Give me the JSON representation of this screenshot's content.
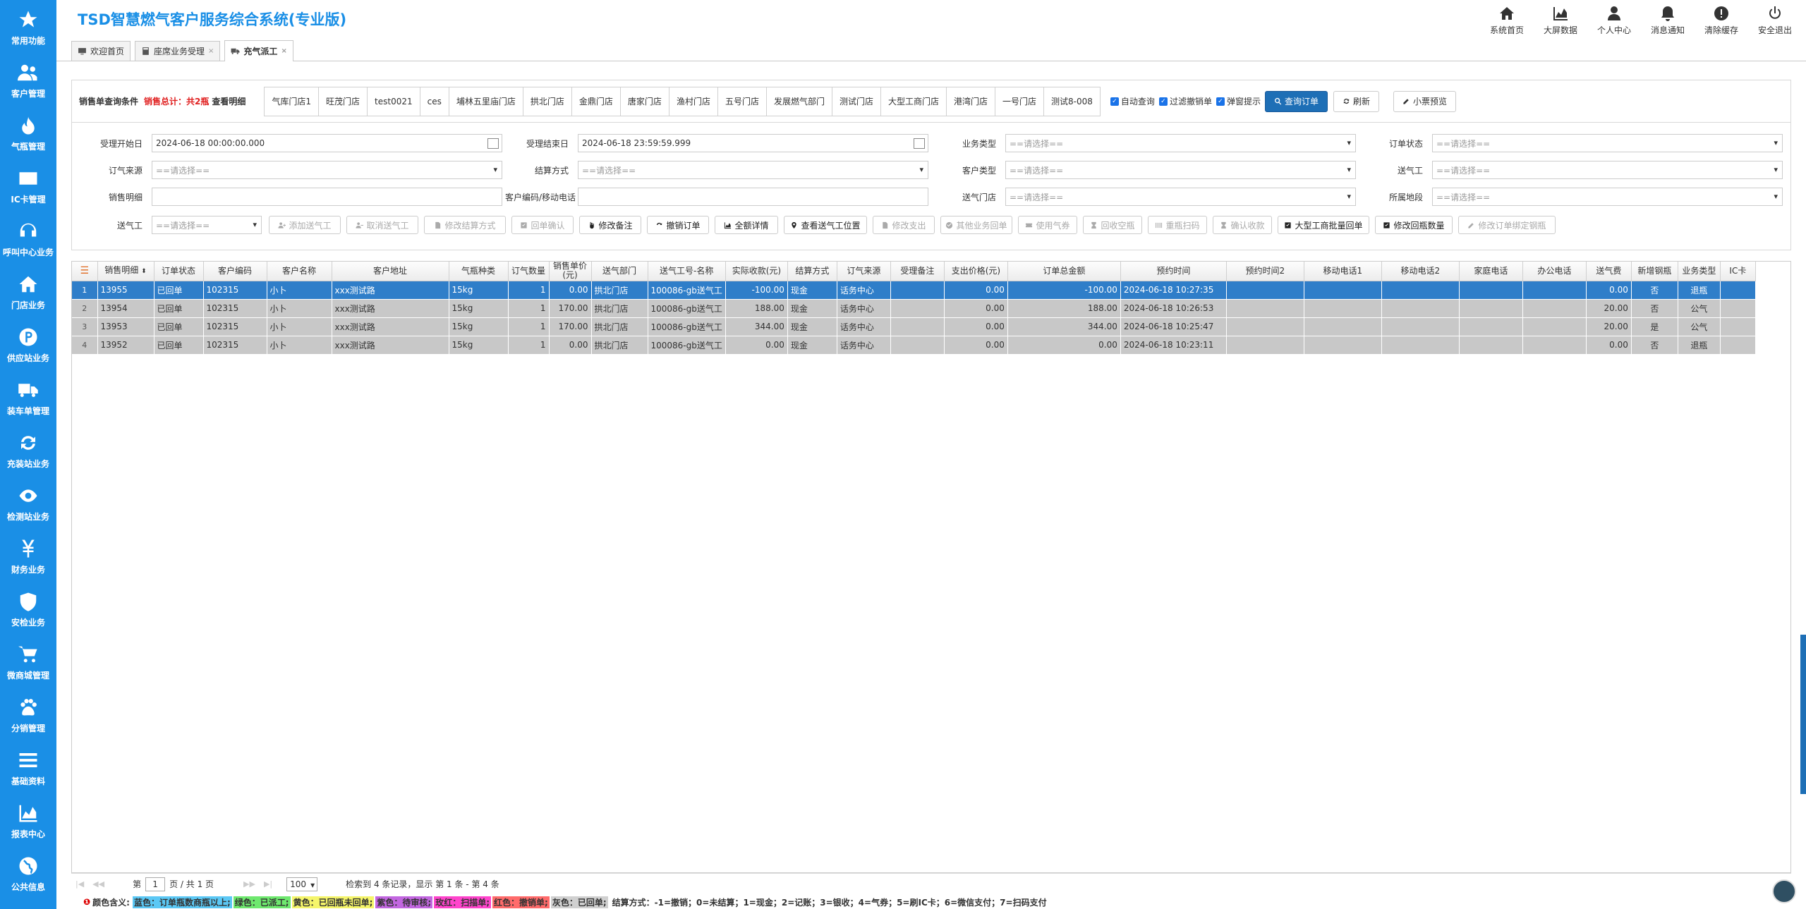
{
  "app": {
    "title": "TSD智慧燃气客户服务综合系统(专业版)"
  },
  "sidebar": {
    "items": [
      {
        "label": "常用功能",
        "icon": "star-icon"
      },
      {
        "label": "客户管理",
        "icon": "users-icon"
      },
      {
        "label": "气瓶管理",
        "icon": "flame-icon"
      },
      {
        "label": "IC卡管理",
        "icon": "card-icon"
      },
      {
        "label": "呼叫中心业务",
        "icon": "headset-icon"
      },
      {
        "label": "门店业务",
        "icon": "home-icon"
      },
      {
        "label": "供应站业务",
        "icon": "parking-icon"
      },
      {
        "label": "装车单管理",
        "icon": "truck-icon"
      },
      {
        "label": "充装站业务",
        "icon": "refresh-icon"
      },
      {
        "label": "检测站业务",
        "icon": "eye-icon"
      },
      {
        "label": "财务业务",
        "icon": "yen-icon"
      },
      {
        "label": "安检业务",
        "icon": "shield-icon"
      },
      {
        "label": "微商城管理",
        "icon": "cart-icon"
      },
      {
        "label": "分销管理",
        "icon": "paw-icon"
      },
      {
        "label": "基础资料",
        "icon": "list-icon"
      },
      {
        "label": "报表中心",
        "icon": "area-chart-icon"
      },
      {
        "label": "公共信息",
        "icon": "globe-icon"
      }
    ]
  },
  "topnav": {
    "items": [
      {
        "label": "系统首页",
        "icon": "home-icon"
      },
      {
        "label": "大屏数据",
        "icon": "area-chart-icon"
      },
      {
        "label": "个人中心",
        "icon": "user-icon"
      },
      {
        "label": "消息通知",
        "icon": "bell-icon"
      },
      {
        "label": "清除缓存",
        "icon": "alert-icon"
      },
      {
        "label": "安全退出",
        "icon": "power-icon"
      }
    ]
  },
  "tabs": [
    {
      "label": "欢迎首页"
    },
    {
      "label": "座席业务受理",
      "close": "×"
    },
    {
      "label": "充气派工",
      "close": "×"
    }
  ],
  "query": {
    "label": "销售单查询条件",
    "total": "销售总计：共2瓶",
    "detail": "查看明细",
    "stores": [
      "气库门店1",
      "旺茂门店",
      "test0021",
      "ces",
      "埔林五里庙门店",
      "拱北门店",
      "金鼎门店",
      "唐家门店",
      "渔村门店",
      "五号门店",
      "发展燃气部门",
      "测试门店",
      "大型工商门店",
      "港湾门店",
      "一号门店",
      "测试8-008"
    ],
    "checks": [
      "自动查询",
      "过滤撤销单",
      "弹窗提示"
    ],
    "search_btn": "查询订单",
    "refresh_btn": "刷新",
    "preview_btn": "小票预览"
  },
  "filters": {
    "start_label": "受理开始日",
    "start_value": "2024-06-18 00:00:00.000",
    "end_label": "受理结束日",
    "end_value": "2024-06-18 23:59:59.999",
    "biz_label": "业务类型",
    "status_label": "订单状态",
    "source_label": "订气来源",
    "settle_label": "结算方式",
    "ctype_label": "客户类型",
    "worker_label": "送气工",
    "detail_label": "销售明细",
    "code_label": "客户编码/移动电话",
    "store_label": "送气门店",
    "area_label": "所属地段",
    "worker2_label": "送气工",
    "placeholder": "==请选择=="
  },
  "actions": [
    {
      "label": "添加送气工",
      "icon": "user-plus-icon",
      "enabled": false
    },
    {
      "label": "取消送气工",
      "icon": "user-minus-icon",
      "enabled": false
    },
    {
      "label": "修改结算方式",
      "icon": "doc-icon",
      "enabled": false
    },
    {
      "label": "回单确认",
      "icon": "check-icon",
      "enabled": false
    },
    {
      "label": "修改备注",
      "icon": "hand-icon",
      "enabled": true
    },
    {
      "label": "撤销订单",
      "icon": "undo-icon",
      "enabled": true
    },
    {
      "label": "全额详情",
      "icon": "chart-icon",
      "enabled": true
    },
    {
      "label": "查看送气工位置",
      "icon": "pin-icon",
      "enabled": true
    },
    {
      "label": "修改支出",
      "icon": "doc-icon",
      "enabled": false
    },
    {
      "label": "其他业务回单",
      "icon": "check-circle-icon",
      "enabled": false
    },
    {
      "label": "使用气券",
      "icon": "ticket-icon",
      "enabled": false
    },
    {
      "label": "回收空瓶",
      "icon": "hourglass-icon",
      "enabled": false
    },
    {
      "label": "重瓶扫码",
      "icon": "barcode-icon",
      "enabled": false
    },
    {
      "label": "确认收款",
      "icon": "hourglass-icon",
      "enabled": false
    },
    {
      "label": "大型工商批量回单",
      "icon": "check-icon",
      "enabled": true
    },
    {
      "label": "修改回瓶数量",
      "icon": "check-icon",
      "enabled": true
    },
    {
      "label": "修改订单绑定钢瓶",
      "icon": "edit-icon",
      "enabled": false
    }
  ],
  "table": {
    "columns": [
      "销售明细",
      "订单状态",
      "客户编码",
      "客户名称",
      "客户地址",
      "气瓶种类",
      "订气数量",
      "销售单价(元)",
      "送气部门",
      "送气工号-名称",
      "实际收款(元)",
      "结算方式",
      "订气来源",
      "受理备注",
      "支出价格(元)",
      "订单总金额",
      "预约时间",
      "预约时间2",
      "移动电话1",
      "移动电话2",
      "家庭电话",
      "办公电话",
      "送气费",
      "新增钢瓶",
      "业务类型",
      "IC卡"
    ],
    "rows": [
      {
        "n": "1",
        "c": [
          "13955",
          "已回单",
          "102315",
          "小卜",
          "xxx测试路",
          "15kg",
          "1",
          "0.00",
          "拱北门店",
          "100086-gb送气工",
          "-100.00",
          "现金",
          "话务中心",
          "",
          "0.00",
          "-100.00",
          "2024-06-18 10:27:35",
          "",
          "",
          "",
          "",
          "",
          "0.00",
          "否",
          "退瓶",
          ""
        ]
      },
      {
        "n": "2",
        "c": [
          "13954",
          "已回单",
          "102315",
          "小卜",
          "xxx测试路",
          "15kg",
          "1",
          "170.00",
          "拱北门店",
          "100086-gb送气工",
          "188.00",
          "现金",
          "话务中心",
          "",
          "0.00",
          "188.00",
          "2024-06-18 10:26:53",
          "",
          "",
          "",
          "",
          "",
          "20.00",
          "否",
          "公气",
          ""
        ]
      },
      {
        "n": "3",
        "c": [
          "13953",
          "已回单",
          "102315",
          "小卜",
          "xxx测试路",
          "15kg",
          "1",
          "170.00",
          "拱北门店",
          "100086-gb送气工",
          "344.00",
          "现金",
          "话务中心",
          "",
          "0.00",
          "344.00",
          "2024-06-18 10:25:47",
          "",
          "",
          "",
          "",
          "",
          "20.00",
          "是",
          "公气",
          ""
        ]
      },
      {
        "n": "4",
        "c": [
          "13952",
          "已回单",
          "102315",
          "小卜",
          "xxx测试路",
          "15kg",
          "1",
          "0.00",
          "拱北门店",
          "100086-gb送气工",
          "0.00",
          "现金",
          "话务中心",
          "",
          "0.00",
          "0.00",
          "2024-06-18 10:23:11",
          "",
          "",
          "",
          "",
          "",
          "0.00",
          "否",
          "退瓶",
          ""
        ]
      }
    ]
  },
  "pager": {
    "page_prefix": "第",
    "page": "1",
    "page_suffix": "页 / 共 1 页",
    "size": "100",
    "info": "检索到 4 条记录，显示 第 1 条 - 第 4 条"
  },
  "legend": {
    "prefix": "颜色含义:",
    "items": [
      {
        "text": "蓝色：订单瓶数商瓶以上;",
        "color": "#5bc8f5"
      },
      {
        "text": "绿色：已派工;",
        "color": "#6ee86e"
      },
      {
        "text": "黄色：已回瓶未回单;",
        "color": "#f5f56a"
      },
      {
        "text": "紫色：待审核;",
        "color": "#c266e0"
      },
      {
        "text": "玫红：扫描单;",
        "color": "#ff44cc"
      },
      {
        "text": "红色：撤销单;",
        "color": "#ff6b6b"
      },
      {
        "text": "灰色：已回单;",
        "color": "#d0d0d0"
      }
    ],
    "settle": "结算方式：-1=撤销；0=未结算；1=现金；2=记账；3=银收；4=气券；5=刷IC卡；6=微信支付；7=扫码支付"
  }
}
